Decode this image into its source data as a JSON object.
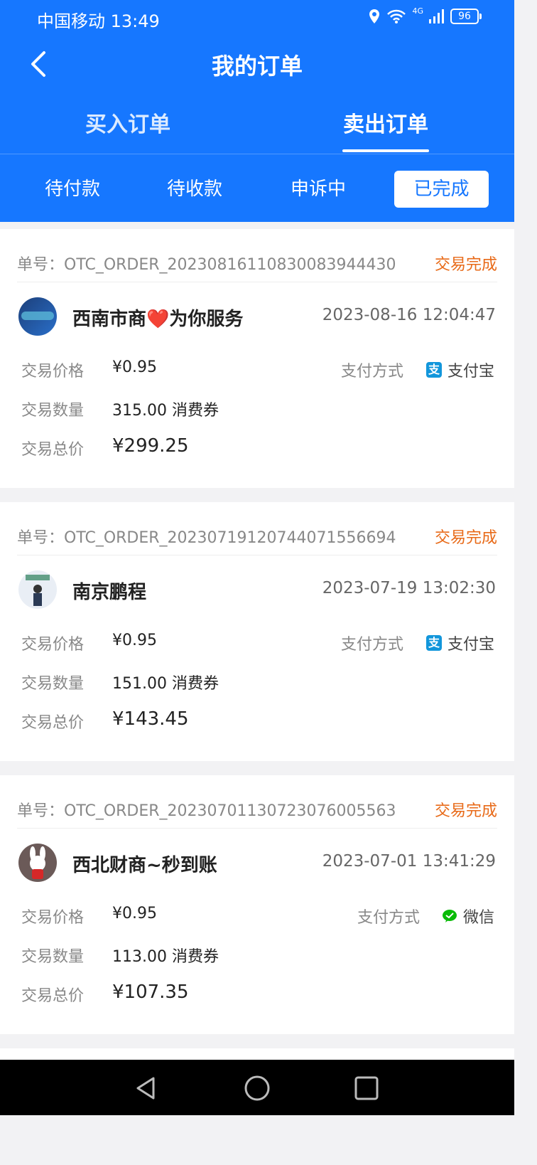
{
  "status_bar": {
    "carrier_time": "中国移动 13:49",
    "battery": "96",
    "network": "4G"
  },
  "header": {
    "title": "我的订单"
  },
  "tabs": [
    {
      "label": "买入订单"
    },
    {
      "label": "卖出订单"
    }
  ],
  "filters": [
    {
      "label": "待付款"
    },
    {
      "label": "待收款"
    },
    {
      "label": "申诉中"
    },
    {
      "label": "已完成"
    }
  ],
  "labels": {
    "price": "交易价格",
    "quantity": "交易数量",
    "total": "交易总价",
    "pay_method": "支付方式"
  },
  "orders": [
    {
      "order_no": "单号：OTC_ORDER_20230816110830083944430",
      "status": "交易完成",
      "seller": "西南市商❤️为你服务",
      "time": "2023-08-16 12:04:47",
      "price": "¥0.95",
      "quantity": "315.00 消费券",
      "total": "¥299.25",
      "pay_method": "支付宝",
      "pay_icon_color": "#1296db"
    },
    {
      "order_no": "单号：OTC_ORDER_20230719120744071556694",
      "status": "交易完成",
      "seller": "南京鹏程",
      "time": "2023-07-19 13:02:30",
      "price": "¥0.95",
      "quantity": "151.00 消费券",
      "total": "¥143.45",
      "pay_method": "支付宝",
      "pay_icon_color": "#1296db"
    },
    {
      "order_no": "单号：OTC_ORDER_20230701130723076005563",
      "status": "交易完成",
      "seller": "西北财商~秒到账",
      "time": "2023-07-01 13:41:29",
      "price": "¥0.95",
      "quantity": "113.00 消费券",
      "total": "¥107.35",
      "pay_method": "微信",
      "pay_icon_color": "#09bb07"
    }
  ],
  "colors": {
    "brand": "#1677ff",
    "status": "#e86a18"
  }
}
